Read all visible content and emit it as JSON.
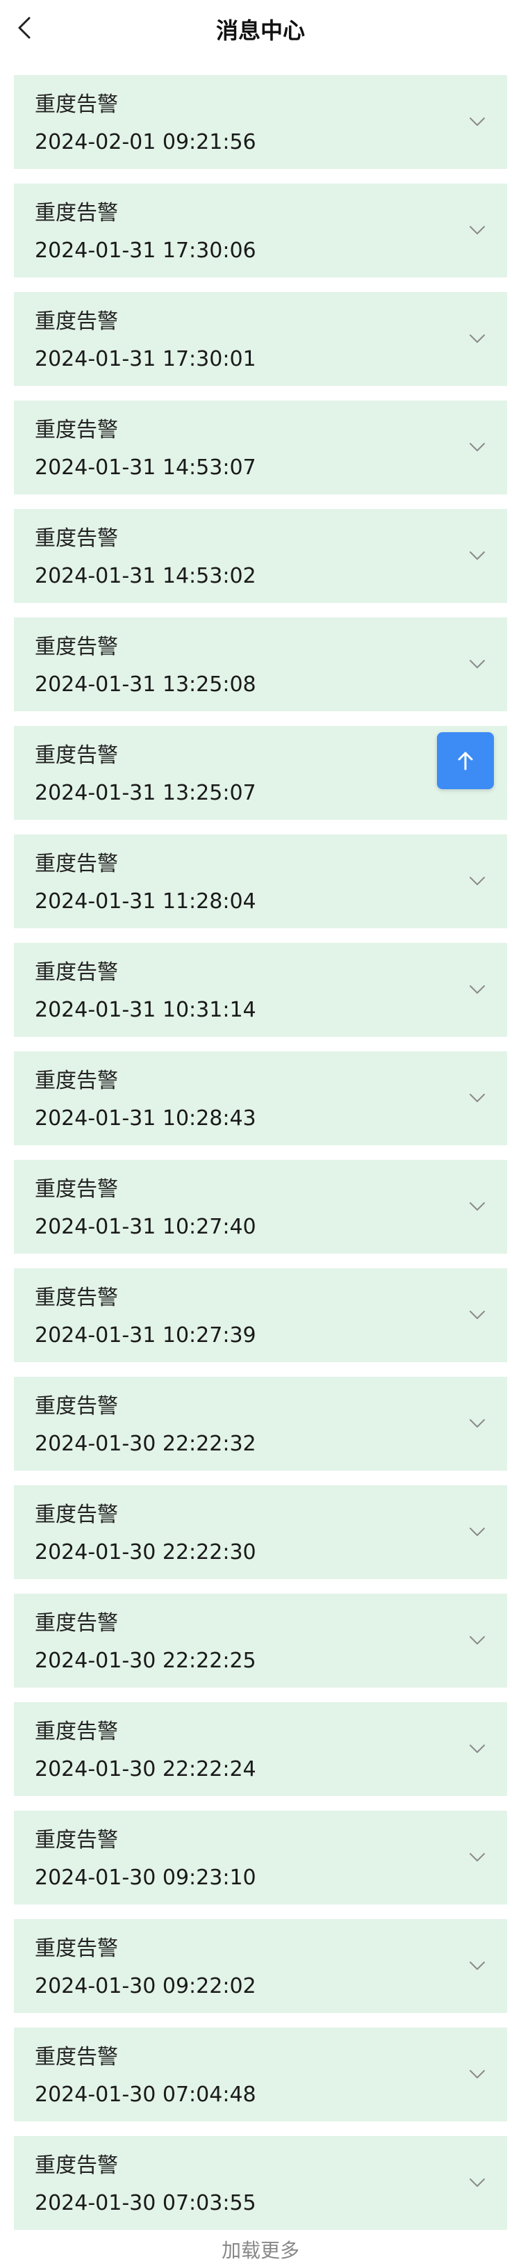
{
  "header": {
    "title": "消息中心",
    "back_icon": "chevron-left-icon"
  },
  "messages": [
    {
      "title": "重度告警",
      "time": "2024-02-01 09:21:56"
    },
    {
      "title": "重度告警",
      "time": "2024-01-31 17:30:06"
    },
    {
      "title": "重度告警",
      "time": "2024-01-31 17:30:01"
    },
    {
      "title": "重度告警",
      "time": "2024-01-31 14:53:07"
    },
    {
      "title": "重度告警",
      "time": "2024-01-31 14:53:02"
    },
    {
      "title": "重度告警",
      "time": "2024-01-31 13:25:08"
    },
    {
      "title": "重度告警",
      "time": "2024-01-31 13:25:07"
    },
    {
      "title": "重度告警",
      "time": "2024-01-31 11:28:04"
    },
    {
      "title": "重度告警",
      "time": "2024-01-31 10:31:14"
    },
    {
      "title": "重度告警",
      "time": "2024-01-31 10:28:43"
    },
    {
      "title": "重度告警",
      "time": "2024-01-31 10:27:40"
    },
    {
      "title": "重度告警",
      "time": "2024-01-31 10:27:39"
    },
    {
      "title": "重度告警",
      "time": "2024-01-30 22:22:32"
    },
    {
      "title": "重度告警",
      "time": "2024-01-30 22:22:30"
    },
    {
      "title": "重度告警",
      "time": "2024-01-30 22:22:25"
    },
    {
      "title": "重度告警",
      "time": "2024-01-30 22:22:24"
    },
    {
      "title": "重度告警",
      "time": "2024-01-30 09:23:10"
    },
    {
      "title": "重度告警",
      "time": "2024-01-30 09:22:02"
    },
    {
      "title": "重度告警",
      "time": "2024-01-30 07:04:48"
    },
    {
      "title": "重度告警",
      "time": "2024-01-30 07:03:55"
    }
  ],
  "load_more": "加载更多",
  "colors": {
    "card_background": "#e2f3e8",
    "accent": "#3d8bf5",
    "chevron": "#8a8a8a",
    "muted_text": "#888888"
  },
  "icons": {
    "expand": "chevron-down-icon",
    "back_to_top": "arrow-up-icon"
  }
}
